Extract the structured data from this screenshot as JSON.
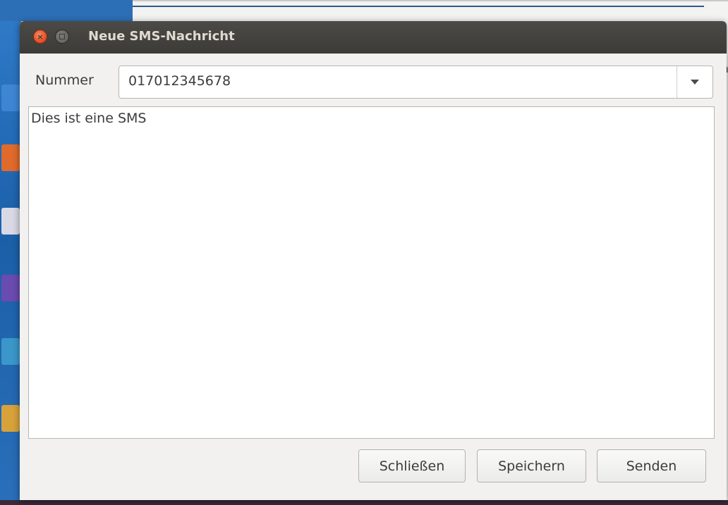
{
  "dialog": {
    "title": "Neue SMS-Nachricht",
    "number_label": "Nummer",
    "number_value": "017012345678",
    "message_text": "Dies ist eine SMS",
    "buttons": {
      "close_label": "Schließen",
      "save_label": "Speichern",
      "send_label": "Senden"
    },
    "window_controls": {
      "close_icon": "close-icon",
      "minimize_icon": "minimize-icon"
    }
  },
  "background": {
    "right_edge_text": [
      "n",
      "r"
    ]
  },
  "colors": {
    "titlebar": "#3c3b37",
    "title_text": "#dfdbd2",
    "close_button": "#e5532b",
    "dialog_bg": "#f2f1f0",
    "text": "#3c3c3c"
  }
}
